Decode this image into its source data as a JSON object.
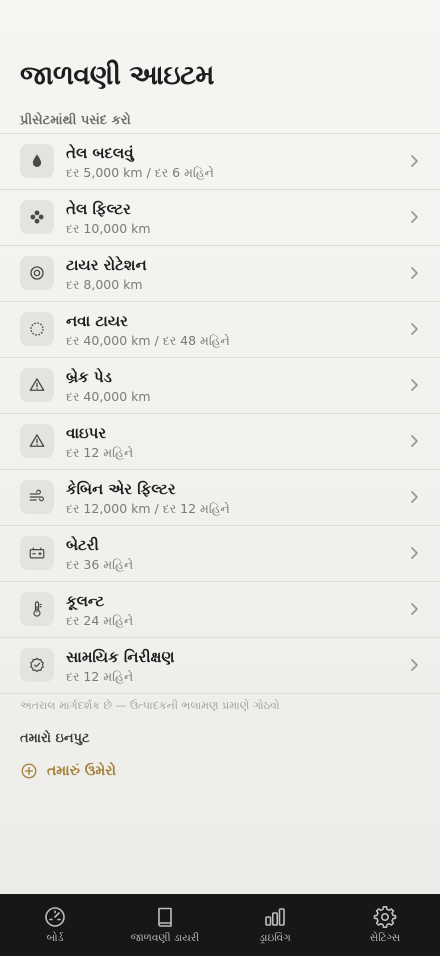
{
  "page": {
    "title": "જાળવણી આઇટમ",
    "section_label": "પ્રીસેટમાંથી પસંદ કરો",
    "items": [
      {
        "title": "તેલ બદલવું",
        "subtitle": "દર 5,000 km / દર 6 મહિને",
        "icon": "drop-icon"
      },
      {
        "title": "તેલ ફિલ્ટર",
        "subtitle": "દર 10,000 km",
        "icon": "filter-icon"
      },
      {
        "title": "ટાયર રોટેશન",
        "subtitle": "દર 8,000 km",
        "icon": "tire-rotation-icon"
      },
      {
        "title": "નવા ટાયર",
        "subtitle": "દર 40,000 km / દર 48 મહિને",
        "icon": "tire-icon"
      },
      {
        "title": "બ્રેક પેડ",
        "subtitle": "દર 40,000 km",
        "icon": "warning-triangle-icon"
      },
      {
        "title": "વાઇપર",
        "subtitle": "દર 12 મહિને",
        "icon": "warning-triangle-icon"
      },
      {
        "title": "કેબિન એર ફિલ્ટર",
        "subtitle": "દર 12,000 km / દર 12 મહિને",
        "icon": "wind-icon"
      },
      {
        "title": "બેટરી",
        "subtitle": "દર 36 મહિને",
        "icon": "battery-icon"
      },
      {
        "title": "કૂલન્ટ",
        "subtitle": "દર 24 મહિને",
        "icon": "thermometer-icon"
      },
      {
        "title": "સામયિક નિરીક્ષણ",
        "subtitle": "દર 12 મહિને",
        "icon": "check-badge-icon"
      }
    ],
    "footnote": "અંતરાલ માર્ગદર્શક છે — ઉત્પાદકની ભલામણ પ્રમાણે ગોઠવો",
    "your_input_label": "તમારો ઇનપુટ",
    "add_label": "તમારું ઉમેરો"
  },
  "tabbar": {
    "tabs": [
      {
        "label": "બોર્ડ",
        "icon": "gauge-icon"
      },
      {
        "label": "જાળવણી ડાયરી",
        "icon": "book-icon"
      },
      {
        "label": "ડ્રાઇવિંગ",
        "icon": "bars-icon"
      },
      {
        "label": "સેટિંગ્સ",
        "icon": "gear-icon"
      }
    ]
  },
  "colors": {
    "accent": "#a67f3a",
    "tabbar_bg": "#171717",
    "icon_box_bg": "#e4e3df"
  }
}
